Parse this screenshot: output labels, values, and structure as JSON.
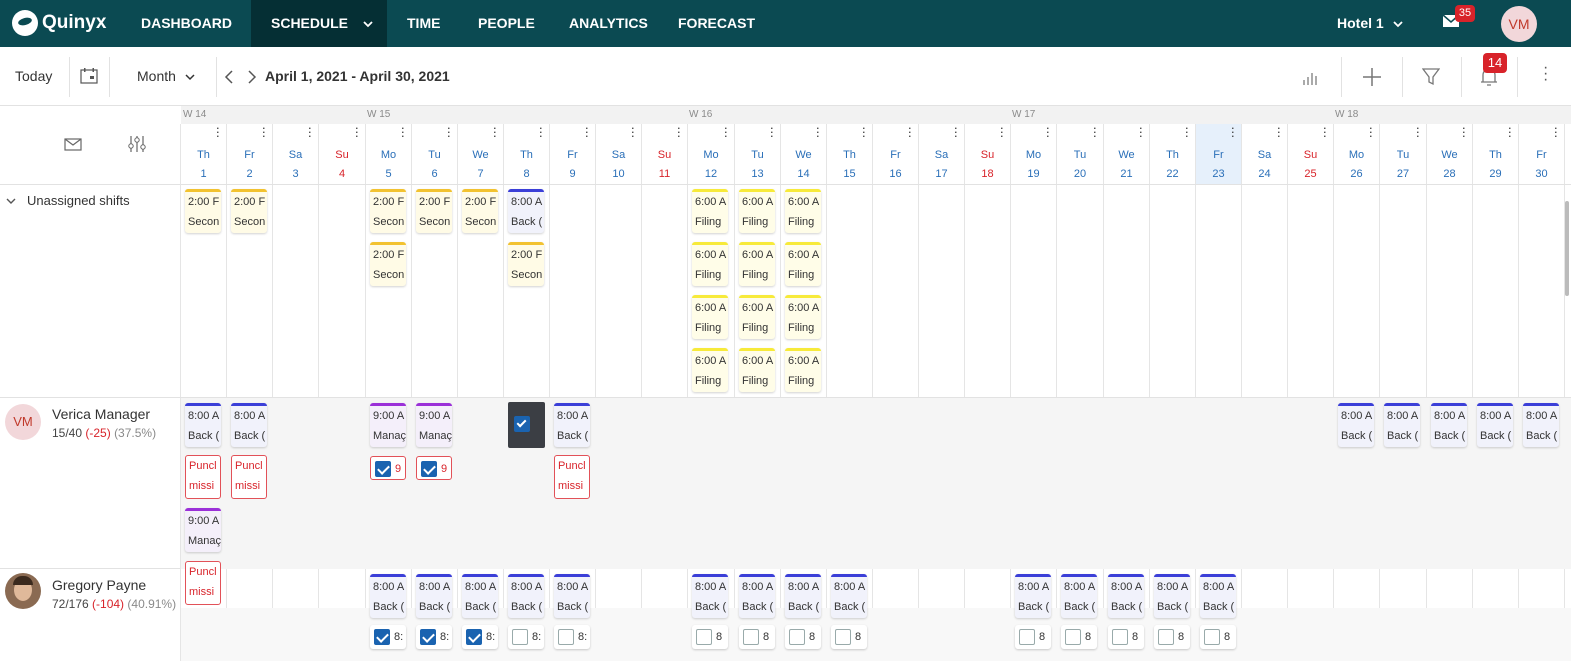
{
  "app": {
    "brand": "Quinyx",
    "nav": [
      "DASHBOARD",
      "SCHEDULE",
      "TIME",
      "PEOPLE",
      "ANALYTICS",
      "FORECAST"
    ],
    "unit": "Hotel 1",
    "messages_badge": "35",
    "user_initials": "VM"
  },
  "toolbar": {
    "today": "Today",
    "view": "Month",
    "range": "April 1, 2021 - April 30, 2021",
    "notifications_badge": "14"
  },
  "weeks": [
    "W 14",
    "W 15",
    "W 16",
    "W 17",
    "W 18"
  ],
  "days": [
    {
      "d": "Th",
      "n": "1"
    },
    {
      "d": "Fr",
      "n": "2"
    },
    {
      "d": "Sa",
      "n": "3"
    },
    {
      "d": "Su",
      "n": "4"
    },
    {
      "d": "Mo",
      "n": "5"
    },
    {
      "d": "Tu",
      "n": "6"
    },
    {
      "d": "We",
      "n": "7"
    },
    {
      "d": "Th",
      "n": "8"
    },
    {
      "d": "Fr",
      "n": "9"
    },
    {
      "d": "Sa",
      "n": "10"
    },
    {
      "d": "Su",
      "n": "11"
    },
    {
      "d": "Mo",
      "n": "12"
    },
    {
      "d": "Tu",
      "n": "13"
    },
    {
      "d": "We",
      "n": "14"
    },
    {
      "d": "Th",
      "n": "15"
    },
    {
      "d": "Fr",
      "n": "16"
    },
    {
      "d": "Sa",
      "n": "17"
    },
    {
      "d": "Su",
      "n": "18"
    },
    {
      "d": "Mo",
      "n": "19"
    },
    {
      "d": "Tu",
      "n": "20"
    },
    {
      "d": "We",
      "n": "21"
    },
    {
      "d": "Th",
      "n": "22"
    },
    {
      "d": "Fr",
      "n": "23"
    },
    {
      "d": "Sa",
      "n": "24"
    },
    {
      "d": "Su",
      "n": "25"
    },
    {
      "d": "Mo",
      "n": "26"
    },
    {
      "d": "Tu",
      "n": "27"
    },
    {
      "d": "We",
      "n": "28"
    },
    {
      "d": "Th",
      "n": "29"
    },
    {
      "d": "Fr",
      "n": "30"
    }
  ],
  "unassigned": {
    "title": "Unassigned shifts",
    "shift_time_pm": "2:00 F",
    "shift_name_second": "Secon",
    "shift_time_am8": "8:00 A",
    "shift_name_back": "Back (",
    "shift_time_am6": "6:00 A",
    "shift_name_filing": "Filing"
  },
  "people": [
    {
      "name": "Verica Manager",
      "initials": "VM",
      "hours": "15/40",
      "diff": "(-25)",
      "pct": "(37.5%)"
    },
    {
      "name": "Gregory Payne",
      "initials": "GP",
      "hours": "72/176",
      "diff": "(-104)",
      "pct": "(40.91%)"
    }
  ],
  "shift_labels": {
    "time_9": "9:00 A",
    "manager": "Manaç",
    "punch1": "Puncl",
    "punch2": "missi",
    "chk_9": "9",
    "chk_8": "8:",
    "chk_8b": "8"
  }
}
